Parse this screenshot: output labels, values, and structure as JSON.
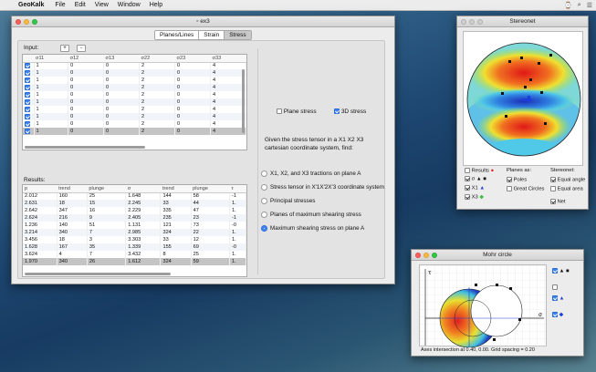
{
  "menubar": {
    "app": "GeoKalk",
    "items": [
      "File",
      "Edit",
      "View",
      "Window",
      "Help"
    ]
  },
  "main": {
    "title": "ex3",
    "tabs": [
      "Planes/Lines",
      "Strain",
      "Stress"
    ],
    "selected_tab": "Stress",
    "input_label": "Input:",
    "plus": "+",
    "minus": "-",
    "input_headers": [
      "",
      "σ11",
      "σ12",
      "σ13",
      "σ22",
      "σ23",
      "σ33"
    ],
    "input_rows": [
      [
        "1",
        "0",
        "0",
        "2",
        "0",
        "4"
      ],
      [
        "1",
        "0",
        "0",
        "2",
        "0",
        "4"
      ],
      [
        "1",
        "0",
        "0",
        "2",
        "0",
        "4"
      ],
      [
        "1",
        "0",
        "0",
        "2",
        "0",
        "4"
      ],
      [
        "1",
        "0",
        "0",
        "2",
        "0",
        "4"
      ],
      [
        "1",
        "0",
        "0",
        "2",
        "0",
        "4"
      ],
      [
        "1",
        "0",
        "0",
        "2",
        "0",
        "4"
      ],
      [
        "1",
        "0",
        "0",
        "2",
        "0",
        "4"
      ],
      [
        "1",
        "0",
        "0",
        "2",
        "0",
        "4"
      ],
      [
        "1",
        "0",
        "0",
        "2",
        "0",
        "4"
      ]
    ],
    "results_label": "Results:",
    "result_headers": [
      "p",
      "trend",
      "plunge",
      "σ",
      "trend",
      "plunge",
      "τ"
    ],
    "result_rows": [
      [
        "2.012",
        "160",
        "25",
        "1.648",
        "144",
        "58",
        "-1"
      ],
      [
        "2.631",
        "18",
        "15",
        "2.245",
        "33",
        "44",
        "1."
      ],
      [
        "2.642",
        "347",
        "16",
        "2.229",
        "335",
        "47",
        "1."
      ],
      [
        "2.624",
        "216",
        "9",
        "2.405",
        "235",
        "23",
        "-1"
      ],
      [
        "1.236",
        "140",
        "51",
        "1.131",
        "121",
        "73",
        "-0"
      ],
      [
        "3.214",
        "340",
        "7",
        "2.985",
        "324",
        "22",
        "1."
      ],
      [
        "3.456",
        "18",
        "3",
        "3.303",
        "33",
        "12",
        "1."
      ],
      [
        "1.628",
        "167",
        "35",
        "1.339",
        "155",
        "69",
        "-0"
      ],
      [
        "3.624",
        "4",
        "7",
        "3.432",
        "8",
        "25",
        "1."
      ],
      [
        "1.970",
        "340",
        "26",
        "1.612",
        "324",
        "59",
        "1."
      ]
    ],
    "plane_stress": "Plane stress",
    "stress_3d": "3D stress",
    "prompt": "Given the stress tensor in a X1 X2 X3 cartesian coordinate system, find:",
    "options": [
      "X1, X2, and X3 tractions on plane A",
      "Stress tensor in X'1X'2X'3 coordinate system",
      "Principal stresses",
      "Planes of maximum shearing stress",
      "Maximum shearing stress on plane A"
    ],
    "selected_option": 4
  },
  "stereonet": {
    "title": "Stereonet",
    "results_label": "Results",
    "planes_as": "Planes as:",
    "poles": "Poles",
    "great_circles": "Great Circles",
    "stereonet_label": "Stereonet:",
    "equal_angle": "Equal angle",
    "equal_area": "Equal area",
    "net": "Net",
    "legend": [
      [
        "σ",
        "●"
      ],
      [
        "X1",
        "▲"
      ],
      [
        "X2",
        "▲"
      ],
      [
        "X3",
        "◆"
      ]
    ]
  },
  "mohr": {
    "title": "Mohr circle",
    "tau_axis": "τ",
    "sigma_axis": "σ",
    "status": "Axes intersection at 0.40, 0.00. Grid spacing = 0.20"
  },
  "colors": {
    "accent": "#3b82f6",
    "hot": "#e02020",
    "cool": "#2030c0"
  }
}
